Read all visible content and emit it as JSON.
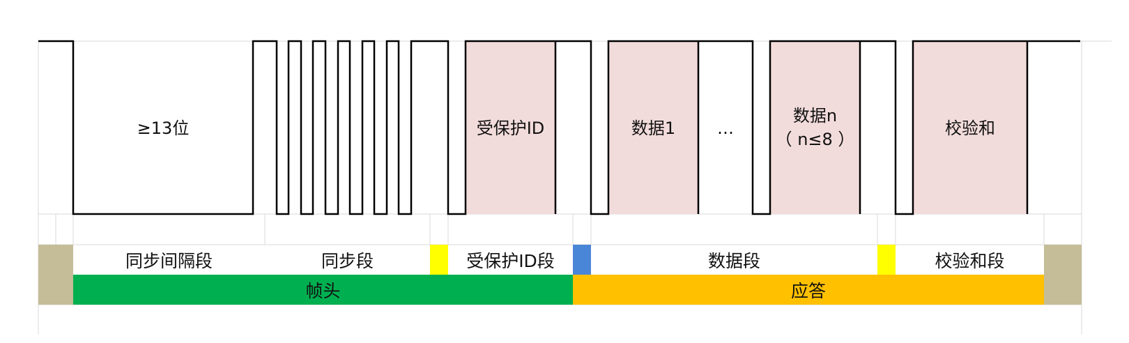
{
  "waveform": {
    "break_label": "≥13位",
    "pid_label": "受保护ID",
    "data1_label": "数据1",
    "ellipsis": "…",
    "datan_label": "数据n",
    "datan_note": "（ n≤8 ）",
    "checksum_label": "校验和"
  },
  "segments": {
    "break_field": "同步间隔段",
    "sync_field": "同步段",
    "pid_field": "受保护ID段",
    "data_field": "数据段",
    "checksum_field": "校验和段"
  },
  "frame": {
    "header": "帧头",
    "response": "应答"
  },
  "colors": {
    "byte_fill": "#f2dcdb",
    "yellow_gap": "#ffff00",
    "blue_gap": "#4a86d8",
    "header_bar": "#00b050",
    "response_bar": "#ffc000",
    "edge_block": "#c4bd97",
    "grid_line": "#d9d9d9",
    "signal": "#000000"
  }
}
